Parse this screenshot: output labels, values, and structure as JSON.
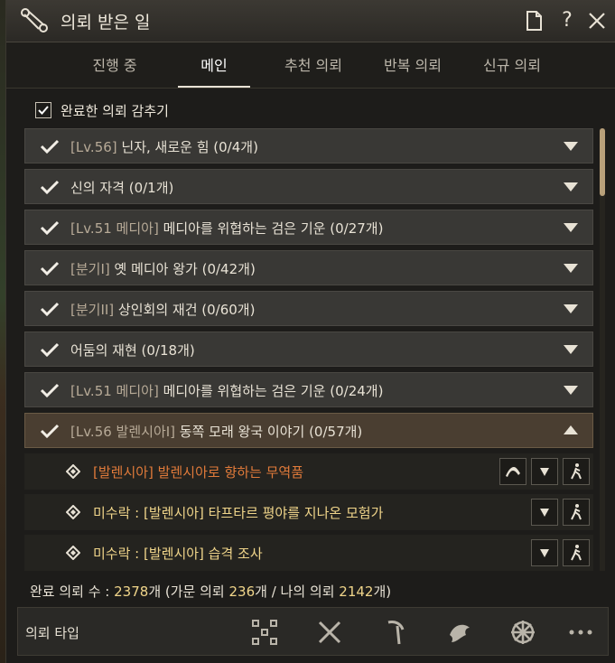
{
  "window": {
    "title": "의뢰 받은 일",
    "icon": "scroll-icon",
    "buttons": [
      "document-icon",
      "help-icon",
      "close-icon"
    ],
    "help_label": "?"
  },
  "tabs": [
    {
      "label": "진행 중",
      "active": false
    },
    {
      "label": "메인",
      "active": true
    },
    {
      "label": "추천 의뢰",
      "active": false
    },
    {
      "label": "반복 의뢰",
      "active": false
    },
    {
      "label": "신규 의뢰",
      "active": false
    }
  ],
  "hide_completed": {
    "label": "완료한 의뢰 감추기",
    "checked": true
  },
  "quests": [
    {
      "tag": "[Lv.56]",
      "title": " 닌자, 새로운 힘 (0/4개)",
      "expanded": false
    },
    {
      "tag": "",
      "title": "신의 자격 (0/1개)",
      "expanded": false
    },
    {
      "tag": "[Lv.51 메디아]",
      "title": " 메디아를 위협하는 검은 기운 (0/27개)",
      "expanded": false
    },
    {
      "tag": "[분기I]",
      "title": " 옛 메디아 왕가 (0/42개)",
      "expanded": false
    },
    {
      "tag": "[분기II]",
      "title": " 상인회의 재건 (0/60개)",
      "expanded": false
    },
    {
      "tag": "",
      "title": "어둠의 재현 (0/18개)",
      "expanded": false
    },
    {
      "tag": "[Lv.51 메디아]",
      "title": " 메디아를 위협하는 검은 기운 (0/24개)",
      "expanded": false
    },
    {
      "tag": "[Lv.56 발렌시아I]",
      "title": " 동쪽 모래 왕국 이야기 (0/57개)",
      "expanded": true
    }
  ],
  "subquests": [
    {
      "text": "[발렌시아] 발렌시아로 향하는 무역품",
      "color": "orange",
      "buttons": [
        "horse-icon",
        "chevron-down-icon",
        "walk-icon"
      ]
    },
    {
      "text": "미수락 : [발렌시아] 타프타르 평야를 지나온 모험가",
      "color": "yellow",
      "buttons": [
        "chevron-down-icon",
        "walk-icon"
      ]
    },
    {
      "text": "미수락 : [발렌시아] 습격 조사",
      "color": "yellow",
      "buttons": [
        "chevron-down-icon",
        "walk-icon"
      ]
    }
  ],
  "stats": {
    "label": "완료 의뢰 수 : ",
    "total": "2378",
    "unit1": "개 (가문 의뢰 ",
    "family": "236",
    "unit2": "개 / 나의 의뢰 ",
    "mine": "2142",
    "unit3": "개)"
  },
  "bottom": {
    "label": "의뢰 타입",
    "icons": [
      "grid-icon",
      "crossed-swords-icon",
      "pickaxe-icon",
      "fish-icon",
      "ship-wheel-icon",
      "more-icon"
    ]
  },
  "colors": {
    "accent": "#f0d58a",
    "orange": "#e07a3a",
    "panel": "#393835",
    "expanded": "#4a3e31"
  }
}
